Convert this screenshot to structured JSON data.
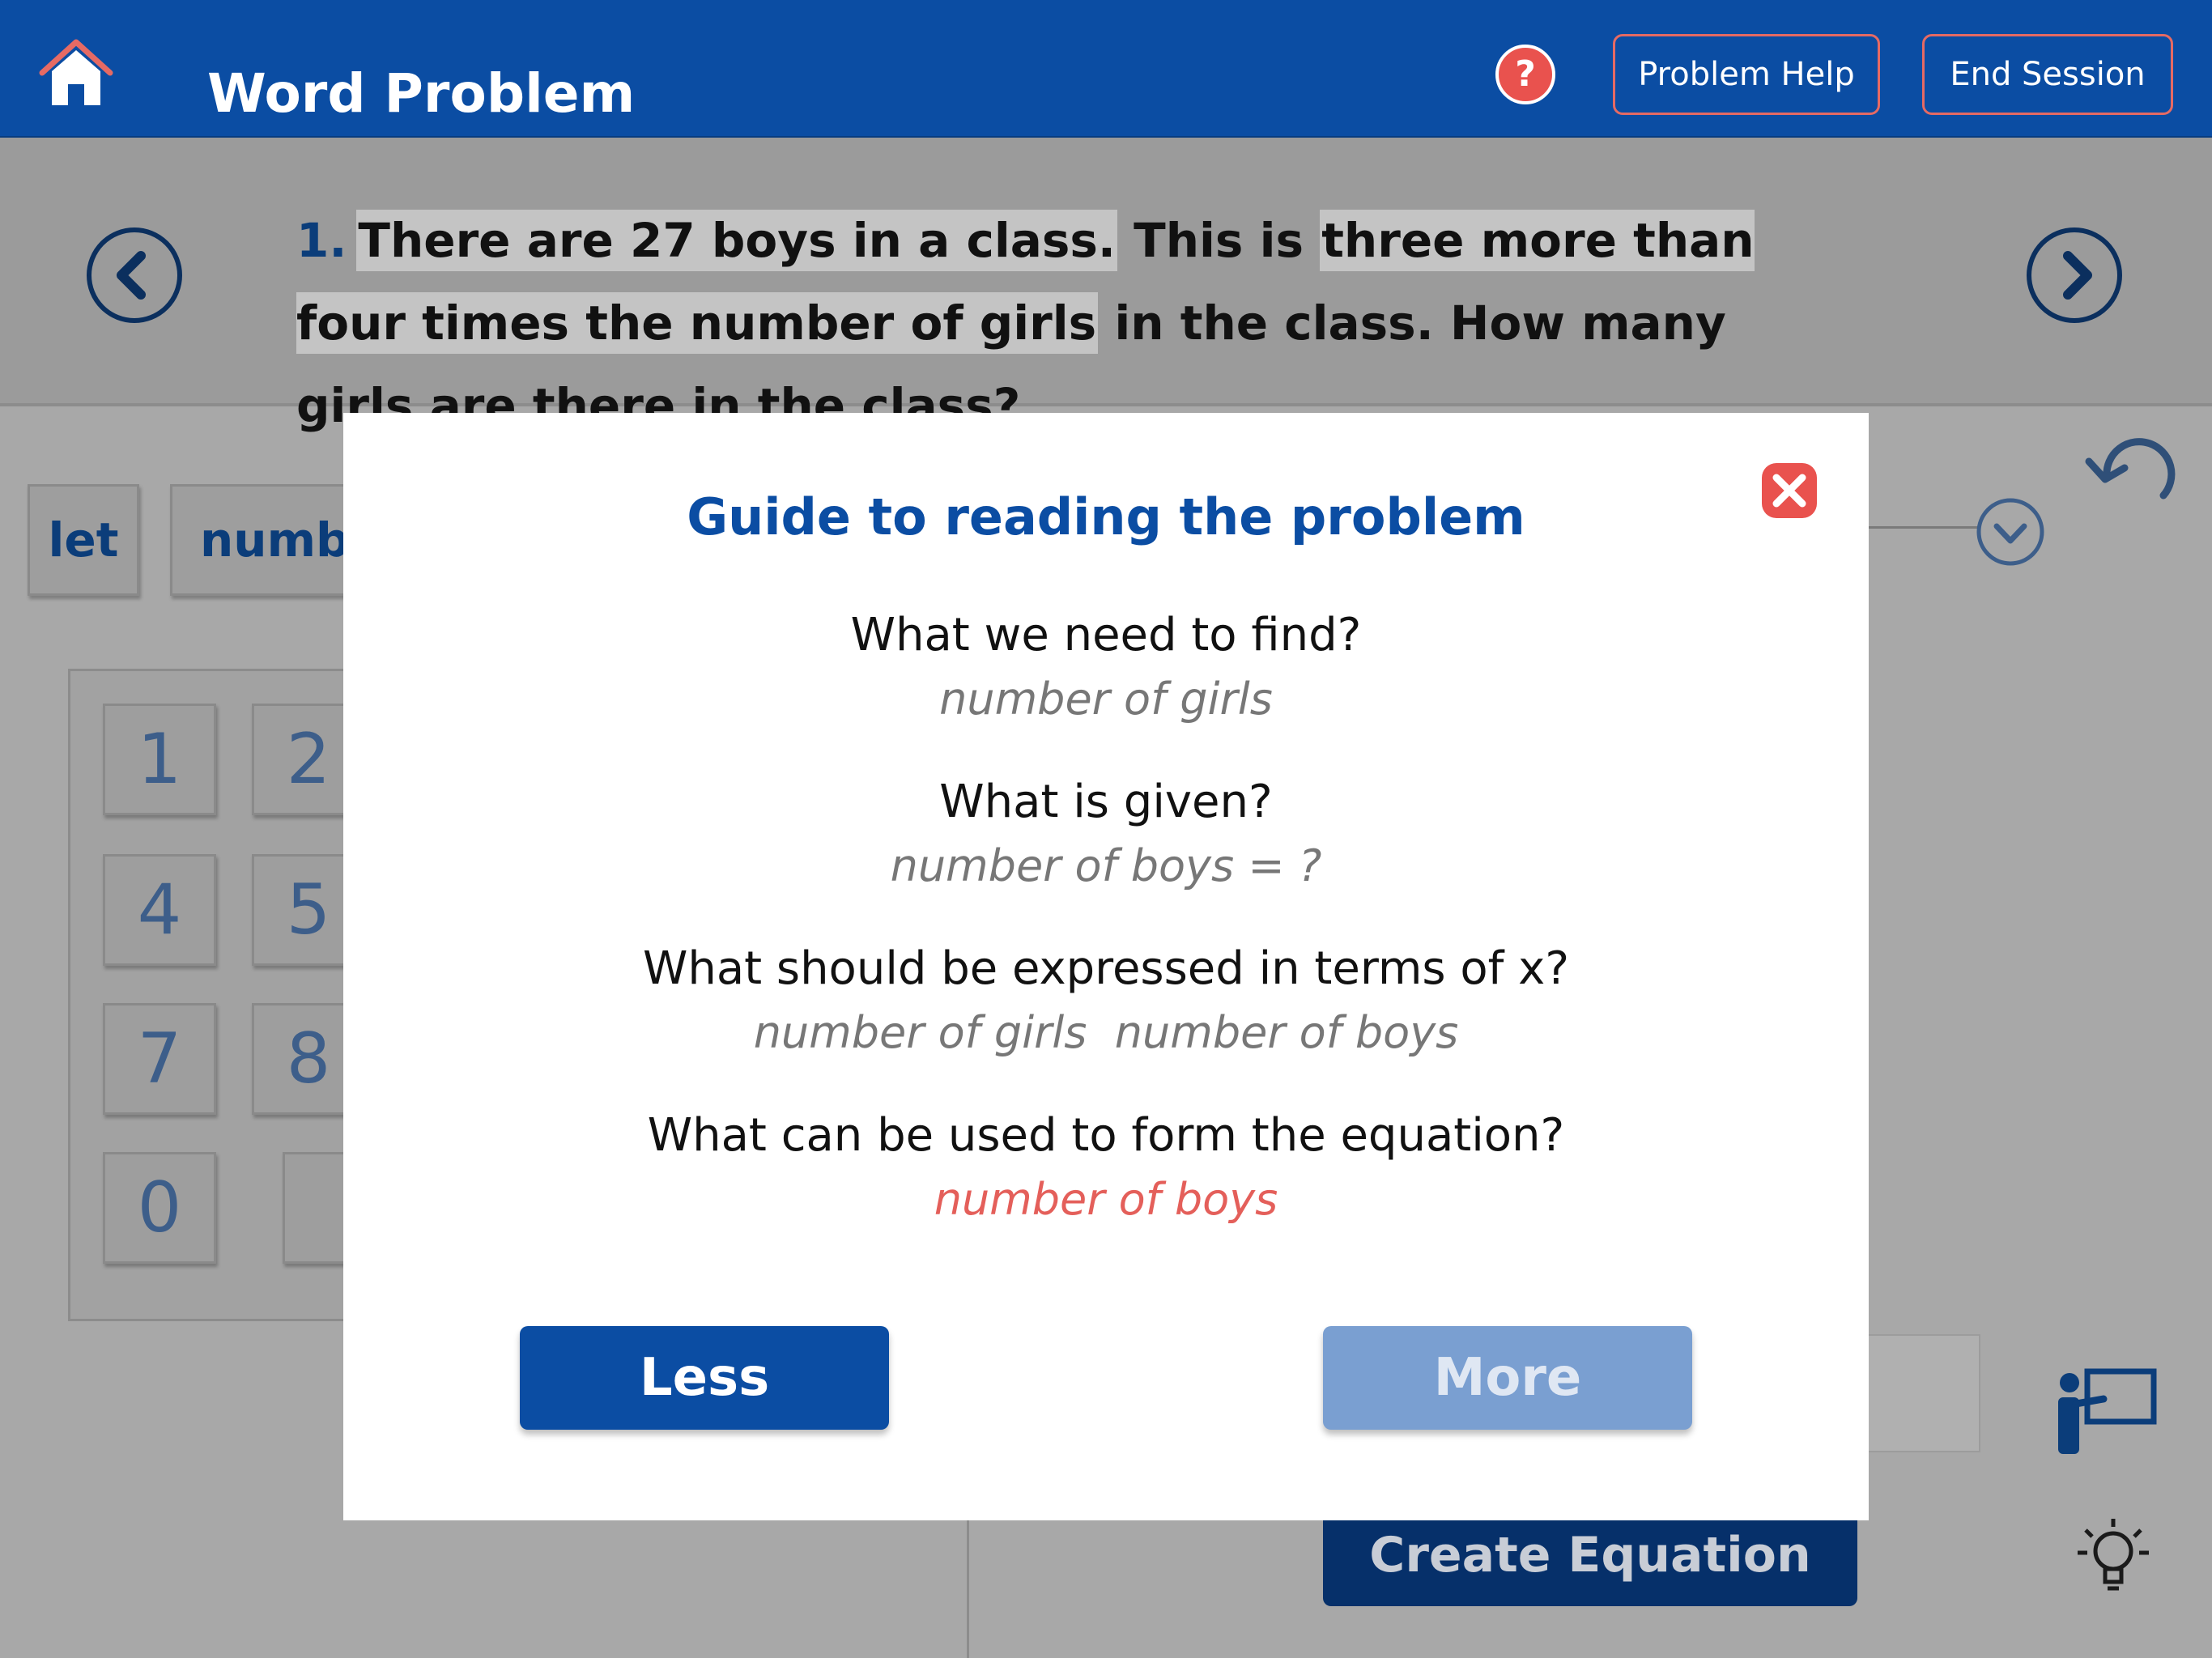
{
  "header": {
    "title": "Word Problem",
    "problem_help_label": "Problem Help",
    "end_session_label": "End Session"
  },
  "problem": {
    "number": "1.",
    "text_parts": [
      {
        "text": "There are 27 boys in a class.",
        "highlight": true
      },
      {
        "text": " This is ",
        "highlight": false
      },
      {
        "text": "three more than four times the number of girls",
        "highlight": true
      },
      {
        "text": " in the class. How many girls are there in the class?",
        "highlight": false
      }
    ]
  },
  "workspace": {
    "token_let": "let",
    "token_number": "numbe",
    "keypad_keys": [
      "1",
      "2",
      "4",
      "5",
      "7",
      "8",
      "0",
      ""
    ],
    "create_equation_label": "Create Equation"
  },
  "modal": {
    "title": "Guide to reading the problem",
    "sections": [
      {
        "question": "What we need to find?",
        "answer": "number of girls"
      },
      {
        "question": "What is given?",
        "answer": "number of boys = ?"
      },
      {
        "question": "What should be expressed in terms of x?",
        "answer": "number of girls  number of boys"
      },
      {
        "question": "What can be used to form the equation?",
        "answer": "number of boys"
      }
    ],
    "less_label": "Less",
    "more_label": "More"
  },
  "colors": {
    "primary": "#0b4da3",
    "accent_red": "#e45f5a",
    "muted_button": "#7a9fd1"
  },
  "icons": [
    "home-icon",
    "help-icon",
    "chevron-left-icon",
    "chevron-right-icon",
    "undo-icon",
    "chevron-down-icon",
    "close-icon",
    "teacher-board-icon",
    "lightbulb-icon"
  ]
}
